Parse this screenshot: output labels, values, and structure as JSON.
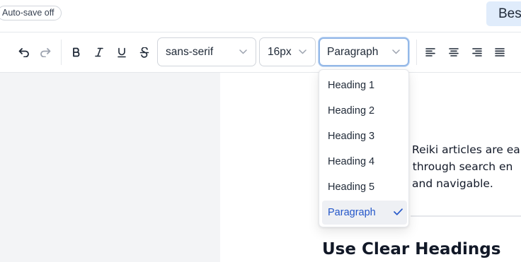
{
  "header": {
    "autosave_label": "Auto-save off",
    "right_button_label": "Bes"
  },
  "toolbar": {
    "font_family": "sans-serif",
    "font_size": "16px",
    "block_type": "Paragraph"
  },
  "dropdown": {
    "items": [
      {
        "label": "Heading 1"
      },
      {
        "label": "Heading 2"
      },
      {
        "label": "Heading 3"
      },
      {
        "label": "Heading 4"
      },
      {
        "label": "Heading 5"
      },
      {
        "label": "Paragraph",
        "selected": true
      }
    ]
  },
  "document": {
    "lines": [
      "Reiki articles are ea",
      "d through search en",
      "and navigable."
    ],
    "heading": "Use Clear Headings"
  },
  "colors": {
    "accent": "#2356c9",
    "focus_border": "#93b8e8",
    "button_bg": "#e0ecfb"
  }
}
